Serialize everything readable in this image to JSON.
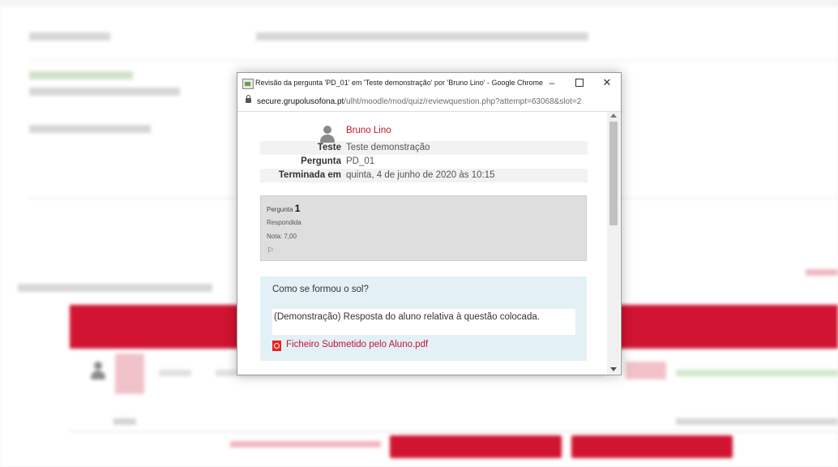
{
  "popup": {
    "window_title": "Revisão da pergunta 'PD_01' em 'Teste demonstração' por 'Bruno Lino' - Google Chrome",
    "url_host": "secure.grupolusofona.pt",
    "url_path": "/ulht/moodle/mod/quiz/reviewquestion.php?attempt=63068&slot=2",
    "icons": {
      "user": "user-icon",
      "flag": "flag-icon",
      "pdf": "pdf-icon",
      "lock": "lock-icon"
    }
  },
  "summary": {
    "user_name": "Bruno Lino",
    "rows": [
      {
        "label": "Teste",
        "value": "Teste demonstração"
      },
      {
        "label": "Pergunta",
        "value": "PD_01"
      },
      {
        "label": "Terminada em",
        "value": "quinta, 4 de junho de 2020 às 10:15"
      }
    ]
  },
  "question_info": {
    "number_label": "Pergunta",
    "number": "1",
    "state": "Respondida",
    "grade": "Nota: 7,00"
  },
  "question": {
    "text": "Como se formou o sol?",
    "answer": "(Demonstração) Resposta do aluno relativa à questão colocada.",
    "attachment": "Ficheiro Submetido pelo Aluno.pdf"
  },
  "colors": {
    "accent": "#c0132d",
    "header_red": "#d11431",
    "formulation_bg": "#e3f1f7",
    "info_bg": "#dedede"
  }
}
